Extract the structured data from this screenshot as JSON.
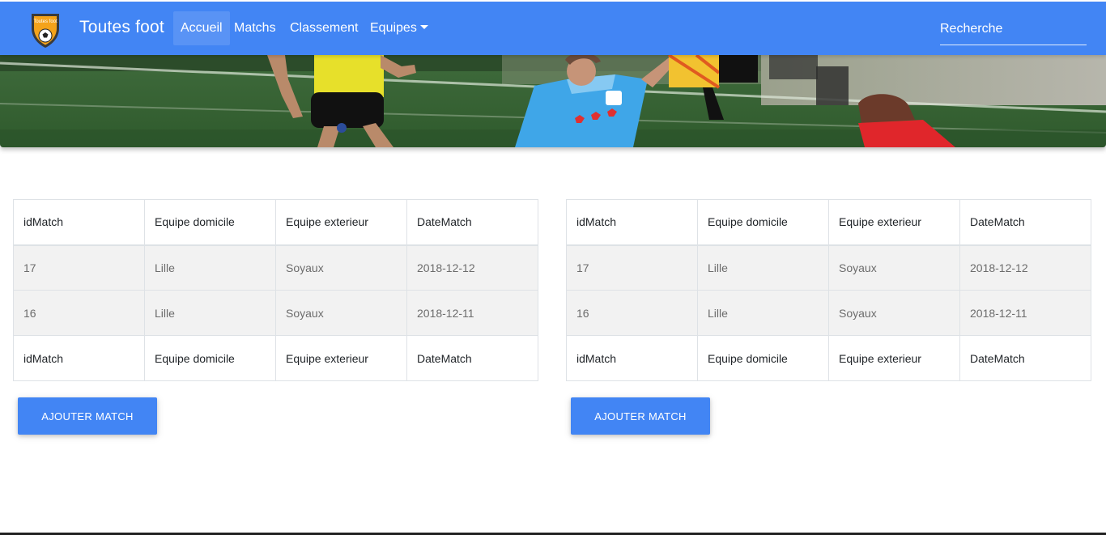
{
  "navbar": {
    "brand": "Toutes foot",
    "logo_text": "Toutes foot",
    "items": [
      {
        "label": "Accueil",
        "active": true
      },
      {
        "label": "Matchs",
        "active": false
      },
      {
        "label": "Classement",
        "active": false
      },
      {
        "label": "Equipes",
        "active": false,
        "dropdown": true
      }
    ],
    "search_placeholder": "Recherche",
    "color": "#4285f4"
  },
  "tables": [
    {
      "headers": [
        "idMatch",
        "Equipe domicile",
        "Equipe exterieur",
        "DateMatch"
      ],
      "rows": [
        [
          "17",
          "Lille",
          "Soyaux",
          "2018-12-12"
        ],
        [
          "16",
          "Lille",
          "Soyaux",
          "2018-12-11"
        ]
      ],
      "footers": [
        "idMatch",
        "Equipe domicile",
        "Equipe exterieur",
        "DateMatch"
      ],
      "button": "AJOUTER MATCH"
    },
    {
      "headers": [
        "idMatch",
        "Equipe domicile",
        "Equipe exterieur",
        "DateMatch"
      ],
      "rows": [
        [
          "17",
          "Lille",
          "Soyaux",
          "2018-12-12"
        ],
        [
          "16",
          "Lille",
          "Soyaux",
          "2018-12-11"
        ]
      ],
      "footers": [
        "idMatch",
        "Equipe domicile",
        "Equipe exterieur",
        "DateMatch"
      ],
      "button": "AJOUTER MATCH"
    }
  ]
}
